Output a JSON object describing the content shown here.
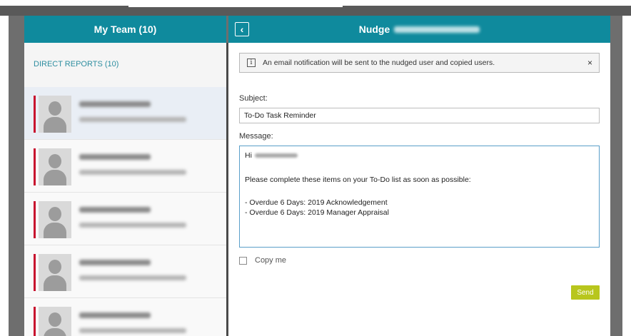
{
  "left_panel": {
    "title": "My Team (10)",
    "section_label": "DIRECT REPORTS (10)",
    "items": [
      {
        "selected": true
      },
      {
        "selected": false
      },
      {
        "selected": false
      },
      {
        "selected": false
      },
      {
        "selected": false
      }
    ]
  },
  "right_panel": {
    "title": "Nudge",
    "back_icon": "chevron-left-icon",
    "info": {
      "text": "An email notification will be sent to the nudged user and copied users.",
      "close": "×"
    },
    "subject": {
      "label": "Subject:",
      "value": "To-Do Task Reminder"
    },
    "message": {
      "label": "Message:",
      "greeting": "Hi",
      "body": "Please complete these items on your To-Do list as soon as possible:",
      "items": [
        "- Overdue 6 Days: 2019 Acknowledgement",
        "- Overdue 6 Days: 2019 Manager Appraisal"
      ]
    },
    "copy_me": "Copy me",
    "send": "Send"
  },
  "colors": {
    "header": "#0f8a9d",
    "accent": "#c8102e",
    "send_button": "#b8c61d",
    "section_label": "#2e8ea0"
  }
}
